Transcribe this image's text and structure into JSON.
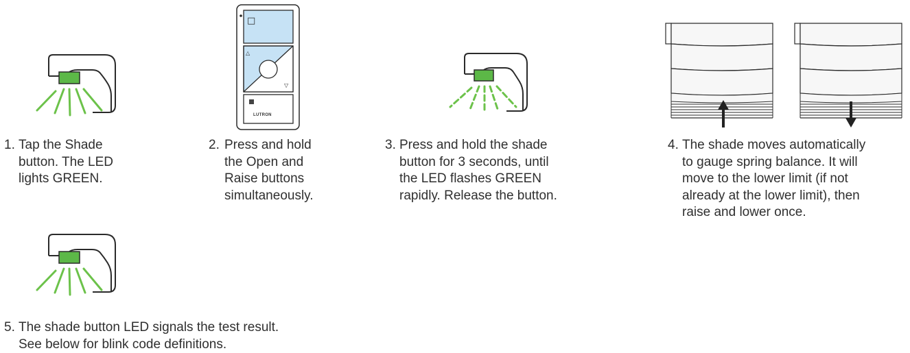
{
  "colors": {
    "led_green": "#5cb847",
    "ray_green": "#6cc24a",
    "remote_blue": "#c6e2f5",
    "outline": "#2a2a2a",
    "shade_fill": "#f7f7f7",
    "text": "#2f2f2f"
  },
  "steps": [
    {
      "number": "1.",
      "text": "Tap the Shade\nbutton. The LED\nlights GREEN.",
      "icon": "shade-led-solid-icon"
    },
    {
      "number": "2.",
      "text": "Press and hold\nthe Open and\nRaise buttons\nsimultaneously.",
      "icon": "pico-remote-icon"
    },
    {
      "number": "3.",
      "text": "Press and hold the shade\nbutton for 3 seconds, until\nthe LED flashes GREEN\nrapidly. Release the button.",
      "icon": "shade-led-flashing-icon"
    },
    {
      "number": "4.",
      "text": "The shade moves automatically\nto gauge spring balance. It will\nmove to the lower limit (if not\nalready at the lower limit), then\nraise and lower once.",
      "icon": "shade-raise-lower-icon"
    },
    {
      "number": "5.",
      "text": "The shade button LED signals the test result.\nSee below for blink code definitions.",
      "icon": "shade-led-solid-icon"
    }
  ],
  "remote": {
    "brand": "LUTRON",
    "open_symbol": "□",
    "raise_symbol": "△",
    "lower_symbol": "▽",
    "favorite_symbol": "▩"
  }
}
